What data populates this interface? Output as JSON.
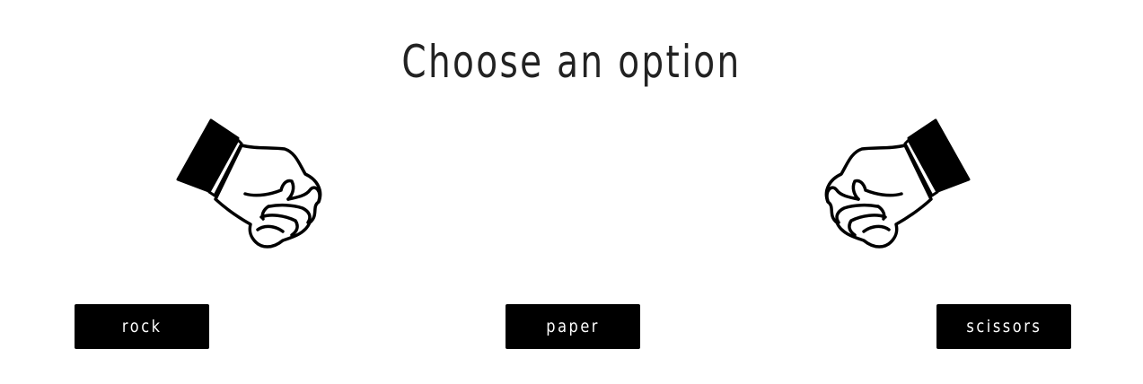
{
  "header": {
    "title": "Choose an option"
  },
  "choices": [
    {
      "label": "rock"
    },
    {
      "label": "paper"
    },
    {
      "label": "scissors"
    }
  ],
  "images": {
    "left": "fist-icon",
    "right": "fist-icon"
  }
}
